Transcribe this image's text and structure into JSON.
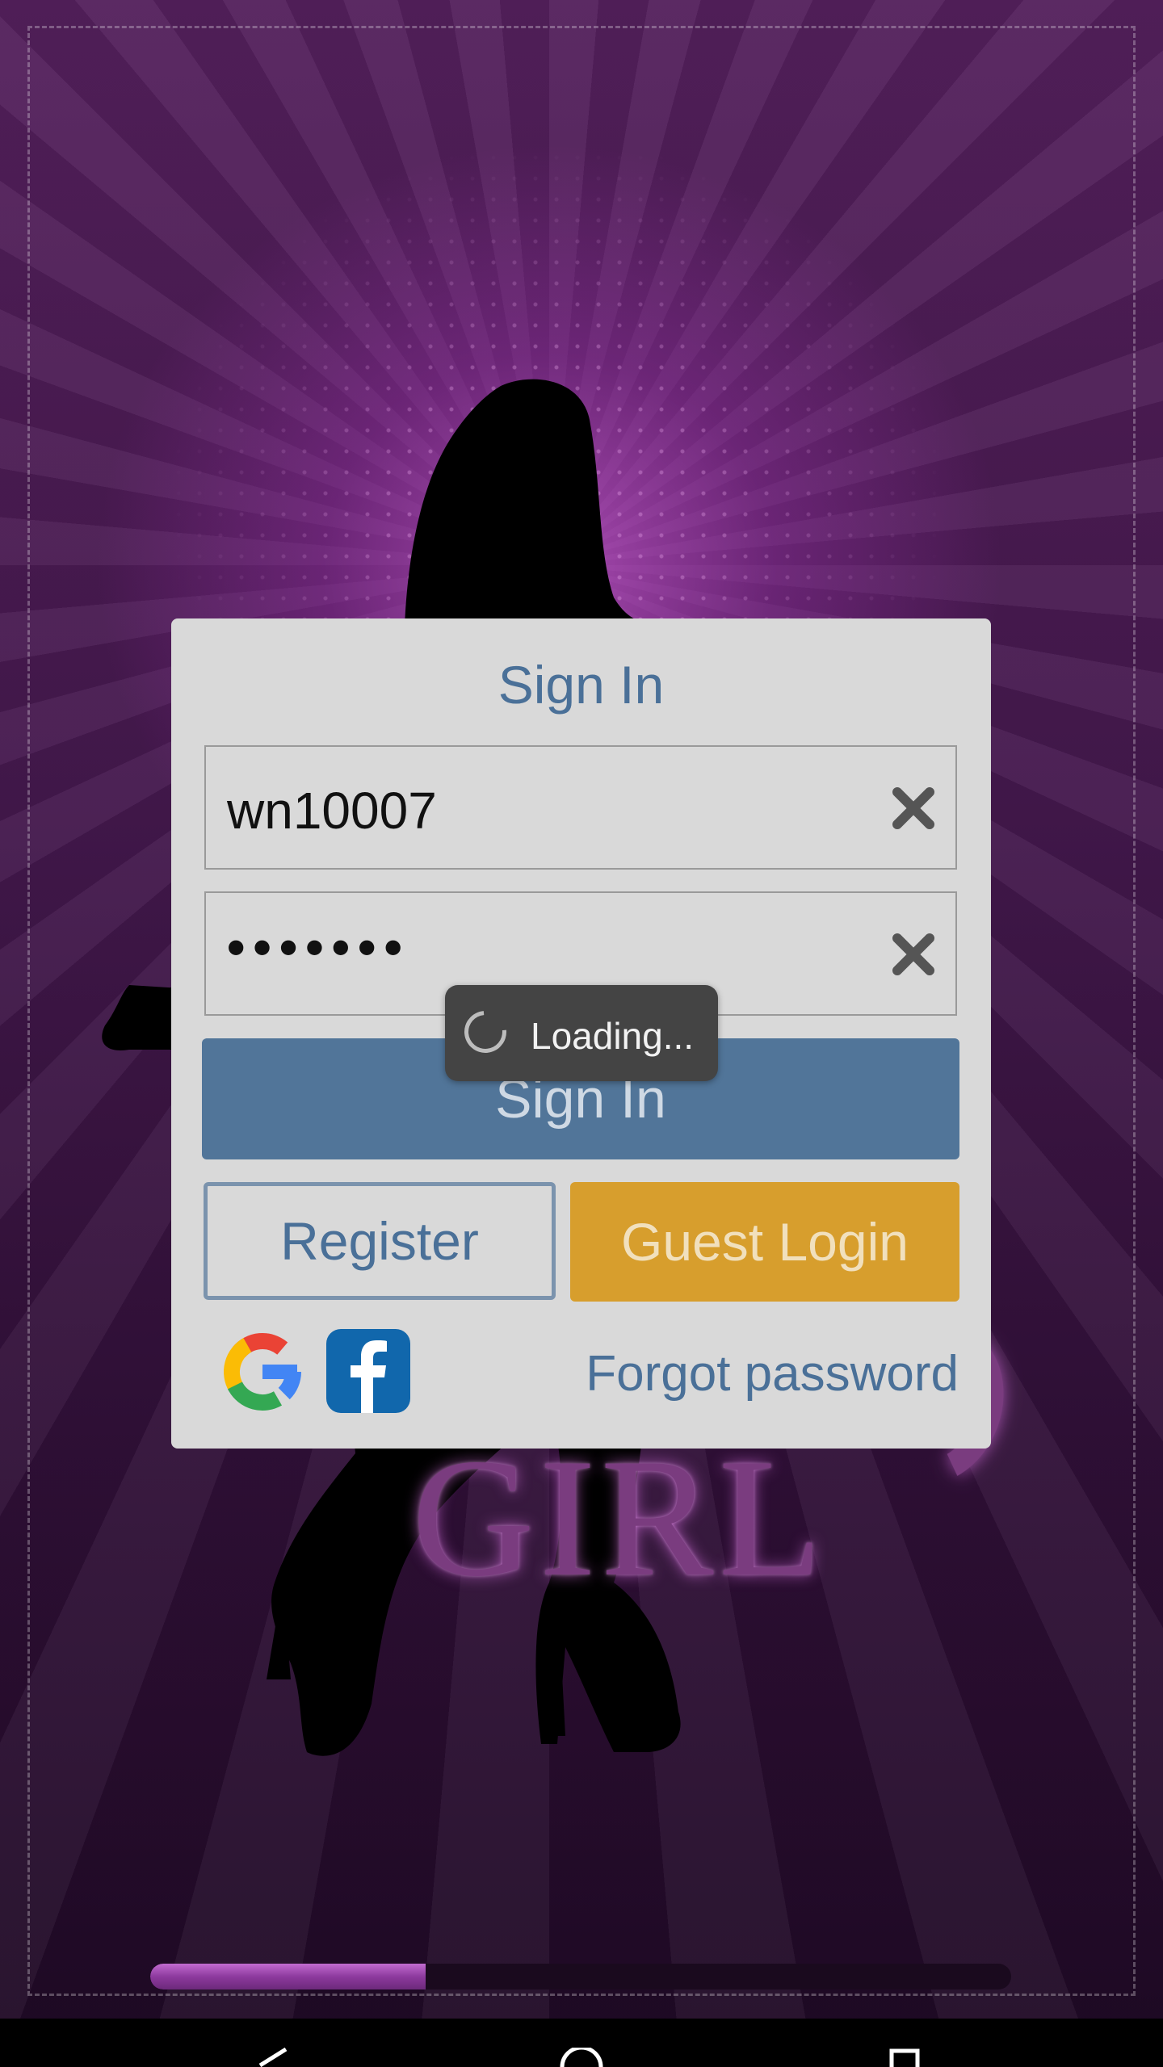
{
  "dialog": {
    "title": "Sign In",
    "username": {
      "value": "wn10007"
    },
    "password": {
      "masked_value": "•••••••"
    },
    "signin_label": "Sign In",
    "register_label": "Register",
    "guest_login_label": "Guest Login",
    "forgot_password_label": "Forgot password",
    "social": {
      "google_icon": "google-icon",
      "facebook_icon": "facebook-icon"
    }
  },
  "toast": {
    "loading_text": "Loading..."
  },
  "background": {
    "logo_text": "GIRL"
  },
  "progress": {
    "value": 0.32
  },
  "colors": {
    "accent_blue": "#517599",
    "guest_gold": "#d79e2d",
    "title_blue": "#4a7098",
    "background_purple": "#54205c"
  },
  "nav_bar": {
    "icons": [
      "back-icon",
      "home-icon",
      "recents-icon"
    ]
  }
}
